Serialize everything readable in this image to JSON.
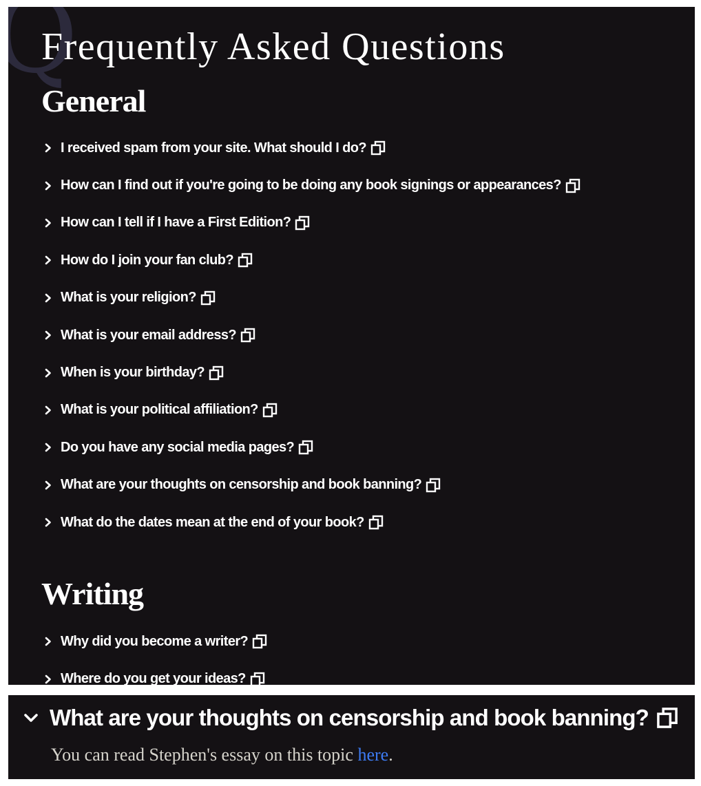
{
  "page": {
    "title": "Frequently Asked Questions"
  },
  "sections": {
    "general": {
      "heading": "General",
      "questions": [
        "I received spam from your site. What should I do?",
        "How can I find out if you're going to be doing any book signings or appearances?",
        "How can I tell if I have a First Edition?",
        "How do I join your fan club?",
        "What is your religion?",
        "What is your email address?",
        "When is your birthday?",
        "What is your political affiliation?",
        "Do you have any social media pages?",
        "What are your thoughts on censorship and book banning?",
        "What do the dates mean at the end of your book?"
      ]
    },
    "writing": {
      "heading": "Writing",
      "questions": [
        "Why did you become a writer?",
        "Where do you get your ideas?"
      ]
    }
  },
  "expanded": {
    "question": "What are your thoughts on censorship and book banning?",
    "answer_before": "You can read Stephen's essay on this topic ",
    "answer_link": "here",
    "answer_after": "."
  },
  "icons": {
    "collapsed": "chevron-right-icon",
    "expanded": "chevron-down-icon",
    "copy": "copy-link-icon"
  },
  "colors": {
    "background": "#141114",
    "text": "#ffffff",
    "link": "#3d7bf2"
  }
}
